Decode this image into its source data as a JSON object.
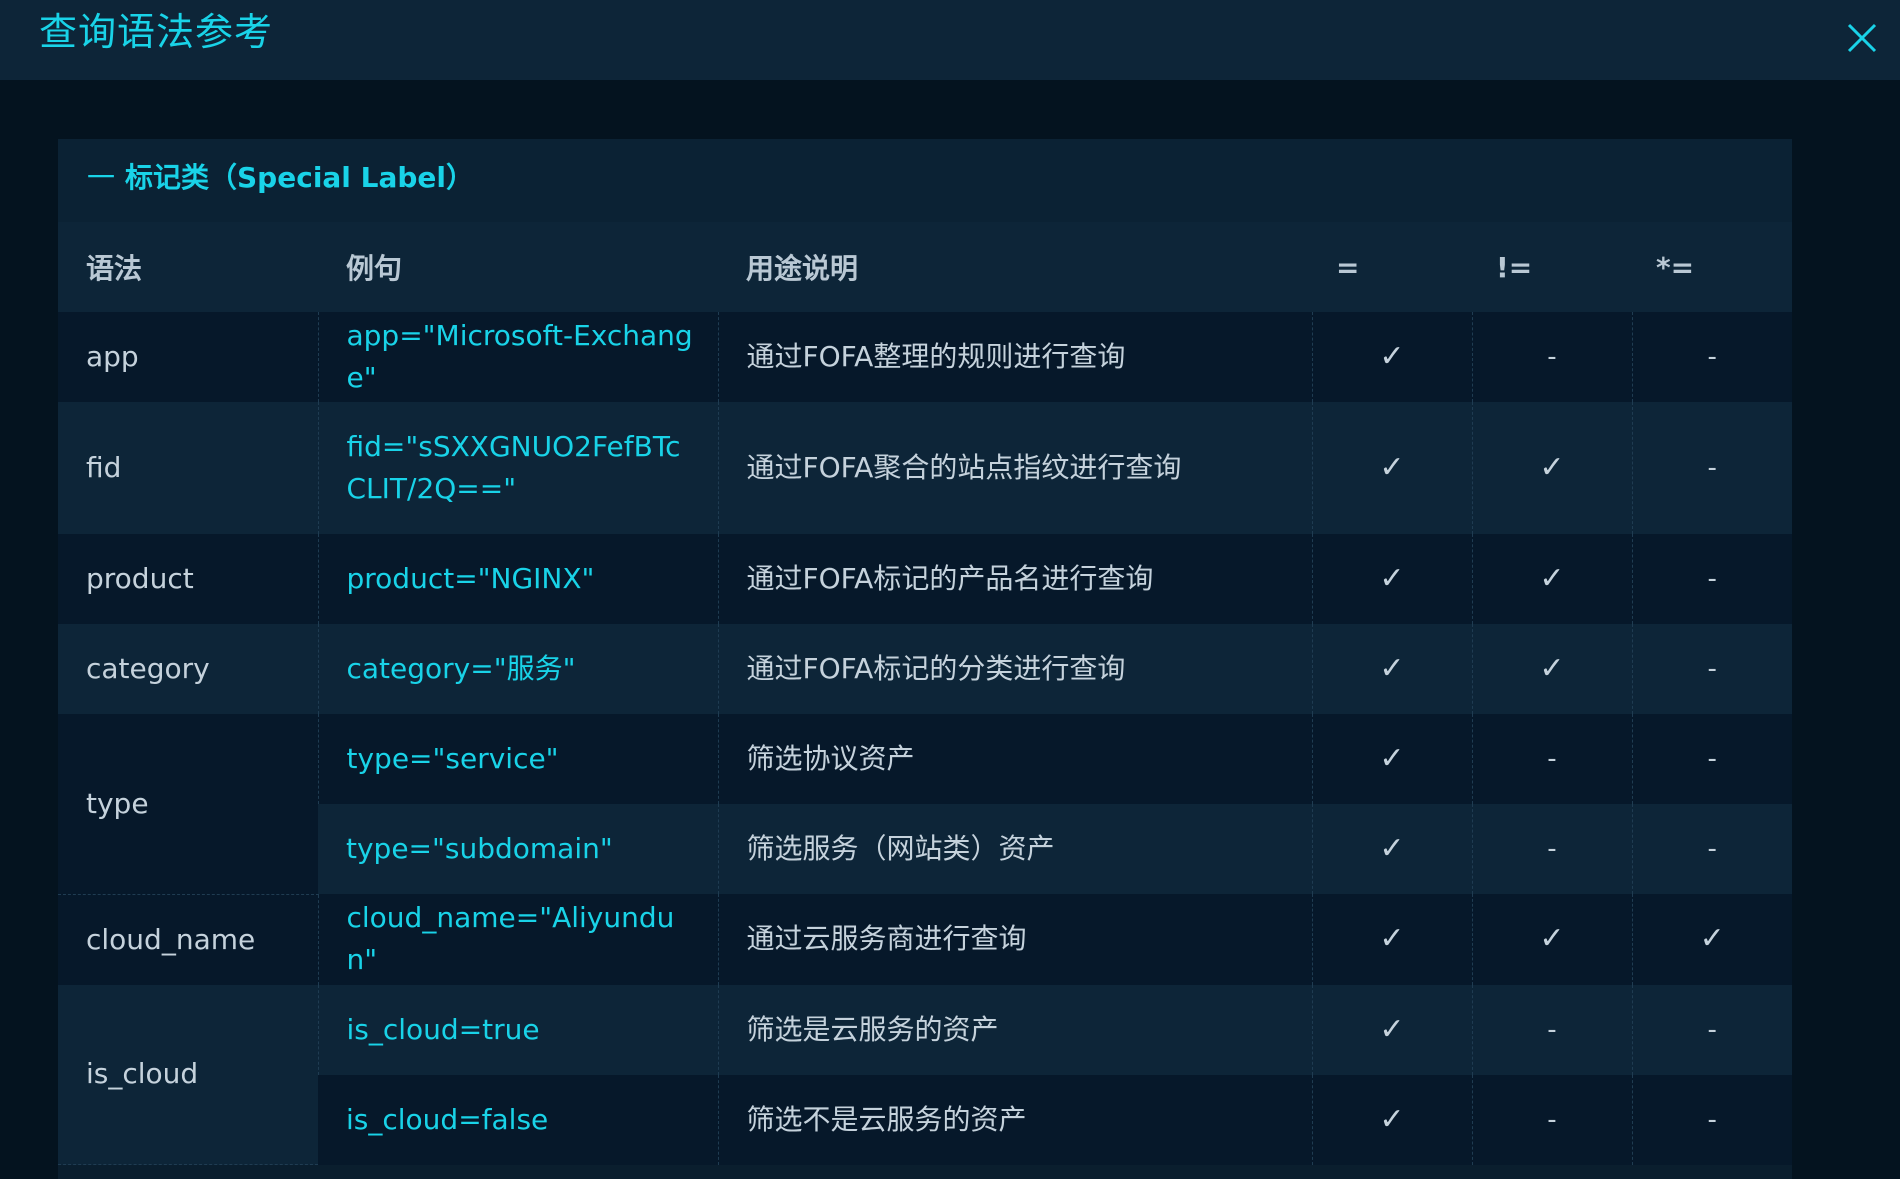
{
  "dialog": {
    "title": "查询语法参考",
    "close_icon": "close-icon"
  },
  "section": {
    "dash": "一",
    "title": "标记类（Special Label）"
  },
  "table": {
    "headers": {
      "syntax": "语法",
      "example": "例句",
      "description": "用途说明",
      "eq": "=",
      "neq": "!=",
      "fuzzy": "*="
    },
    "rows": [
      {
        "syntax": "app",
        "example": "app=\"Microsoft-Exchange\"",
        "description": "通过FOFA整理的规则进行查询",
        "eq": "✓",
        "neq": "-",
        "fuzzy": "-"
      },
      {
        "syntax": "fid",
        "example": "fid=\"sSXXGNUO2FefBTcCLIT/2Q==\"",
        "description": "通过FOFA聚合的站点指纹进行查询",
        "eq": "✓",
        "neq": "✓",
        "fuzzy": "-"
      },
      {
        "syntax": "product",
        "example": "product=\"NGINX\"",
        "description": "通过FOFA标记的产品名进行查询",
        "eq": "✓",
        "neq": "✓",
        "fuzzy": "-"
      },
      {
        "syntax": "category",
        "example": "category=\"服务\"",
        "description": "通过FOFA标记的分类进行查询",
        "eq": "✓",
        "neq": "✓",
        "fuzzy": "-"
      },
      {
        "syntax": "type",
        "example": "type=\"service\"",
        "description": "筛选协议资产",
        "eq": "✓",
        "neq": "-",
        "fuzzy": "-"
      },
      {
        "syntax": "",
        "example": "type=\"subdomain\"",
        "description": "筛选服务（网站类）资产",
        "eq": "✓",
        "neq": "-",
        "fuzzy": "-"
      },
      {
        "syntax": "cloud_name",
        "example": "cloud_name=\"Aliyundun\"",
        "description": "通过云服务商进行查询",
        "eq": "✓",
        "neq": "✓",
        "fuzzy": "✓"
      },
      {
        "syntax": "is_cloud",
        "example": "is_cloud=true",
        "description": "筛选是云服务的资产",
        "eq": "✓",
        "neq": "-",
        "fuzzy": "-"
      },
      {
        "syntax": "",
        "example": "is_cloud=false",
        "description": "筛选不是云服务的资产",
        "eq": "✓",
        "neq": "-",
        "fuzzy": "-"
      }
    ]
  }
}
